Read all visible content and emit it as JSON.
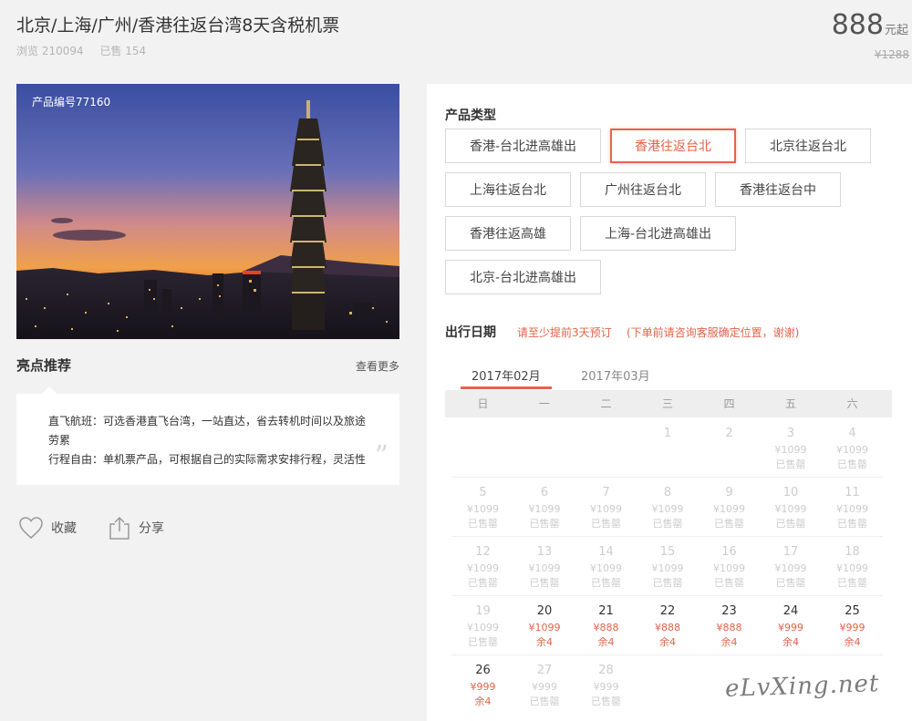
{
  "header": {
    "title": "北京/上海/广州/香港往返台湾8天含税机票",
    "views": "浏览 210094",
    "sold": "已售 154",
    "price": "888",
    "price_unit": "元起",
    "price_original": "¥1288"
  },
  "photo": {
    "code": "产品编号77160"
  },
  "highlights": {
    "title": "亮点推荐",
    "more": "查看更多",
    "line1": "直飞航班：可选香港直飞台湾，一站直达，省去转机时间以及旅途劳累",
    "line2": "行程自由：单机票产品，可根据自己的实际需求安排行程，灵活性",
    "quote_mark": "”"
  },
  "actions": {
    "favorite": "收藏",
    "share": "分享"
  },
  "product_type": {
    "label": "产品类型",
    "options": [
      "香港-台北进高雄出",
      "香港往返台北",
      "北京往返台北",
      "上海往返台北",
      "广州往返台北",
      "香港往返台中",
      "香港往返高雄",
      "上海-台北进高雄出",
      "北京-台北进高雄出"
    ],
    "selected": "香港往返台北"
  },
  "travel_date": {
    "label": "出行日期",
    "note1": "请至少提前3天预订",
    "note2": "(下单前请咨询客服确定位置，谢谢)"
  },
  "calendar": {
    "months": [
      "2017年02月",
      "2017年03月"
    ],
    "active_month": "2017年02月",
    "weekdays": [
      "日",
      "一",
      "二",
      "三",
      "四",
      "五",
      "六"
    ],
    "weeks": [
      [
        null,
        null,
        null,
        {
          "day": "1",
          "price": "",
          "status": "",
          "state": "off"
        },
        {
          "day": "2",
          "price": "",
          "status": "",
          "state": "off"
        },
        {
          "day": "3",
          "price": "¥1099",
          "status": "已售罄",
          "state": "off"
        },
        {
          "day": "4",
          "price": "¥1099",
          "status": "已售罄",
          "state": "off"
        }
      ],
      [
        {
          "day": "5",
          "price": "¥1099",
          "status": "已售罄",
          "state": "off"
        },
        {
          "day": "6",
          "price": "¥1099",
          "status": "已售罄",
          "state": "off"
        },
        {
          "day": "7",
          "price": "¥1099",
          "status": "已售罄",
          "state": "off"
        },
        {
          "day": "8",
          "price": "¥1099",
          "status": "已售罄",
          "state": "off"
        },
        {
          "day": "9",
          "price": "¥1099",
          "status": "已售罄",
          "state": "off"
        },
        {
          "day": "10",
          "price": "¥1099",
          "status": "已售罄",
          "state": "off"
        },
        {
          "day": "11",
          "price": "¥1099",
          "status": "已售罄",
          "state": "off"
        }
      ],
      [
        {
          "day": "12",
          "price": "¥1099",
          "status": "已售罄",
          "state": "off"
        },
        {
          "day": "13",
          "price": "¥1099",
          "status": "已售罄",
          "state": "off"
        },
        {
          "day": "14",
          "price": "¥1099",
          "status": "已售罄",
          "state": "off"
        },
        {
          "day": "15",
          "price": "¥1099",
          "status": "已售罄",
          "state": "off"
        },
        {
          "day": "16",
          "price": "¥1099",
          "status": "已售罄",
          "state": "off"
        },
        {
          "day": "17",
          "price": "¥1099",
          "status": "已售罄",
          "state": "off"
        },
        {
          "day": "18",
          "price": "¥1099",
          "status": "已售罄",
          "state": "off"
        }
      ],
      [
        {
          "day": "19",
          "price": "¥1099",
          "status": "已售罄",
          "state": "off"
        },
        {
          "day": "20",
          "price": "¥1099",
          "status": "余4",
          "state": "on"
        },
        {
          "day": "21",
          "price": "¥888",
          "status": "余4",
          "state": "on"
        },
        {
          "day": "22",
          "price": "¥888",
          "status": "余4",
          "state": "on"
        },
        {
          "day": "23",
          "price": "¥888",
          "status": "余4",
          "state": "on"
        },
        {
          "day": "24",
          "price": "¥999",
          "status": "余4",
          "state": "on"
        },
        {
          "day": "25",
          "price": "¥999",
          "status": "余4",
          "state": "on"
        }
      ],
      [
        {
          "day": "26",
          "price": "¥999",
          "status": "余4",
          "state": "on"
        },
        {
          "day": "27",
          "price": "¥999",
          "status": "已售罄",
          "state": "off"
        },
        {
          "day": "28",
          "price": "¥999",
          "status": "已售罄",
          "state": "off"
        },
        null,
        null,
        null,
        null
      ]
    ]
  },
  "watermark": "eLvXing.net",
  "colors": {
    "accent": "#e2654a",
    "muted": "#cdcdcd"
  }
}
